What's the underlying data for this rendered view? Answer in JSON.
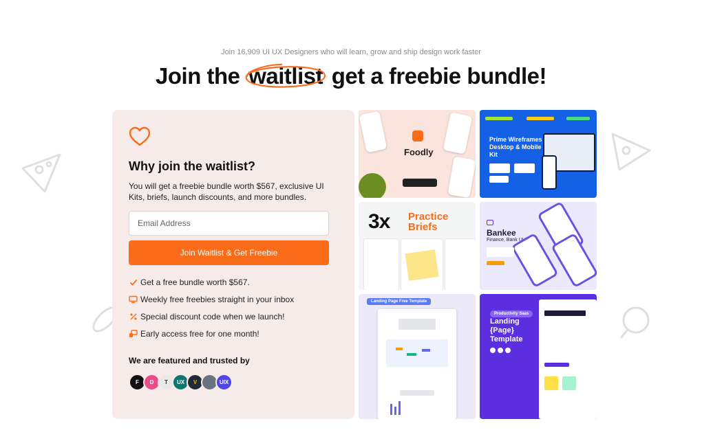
{
  "header": {
    "subtitle": "Join 16,909 UI UX Designers who will learn, grow and ship design work faster",
    "headline_before": "Join the",
    "headline_highlight": "waitlist",
    "headline_after": "get a freebie bundle!"
  },
  "card": {
    "heading": "Why join the waitlist?",
    "description": "You will get a freebie bundle worth $567, exclusive UI Kits, briefs, launch discounts, and more bundles.",
    "email_placeholder": "Email Address",
    "button_label": "Join Waitlist & Get Freebie",
    "benefits": [
      {
        "icon": "check-icon",
        "text": "Get a free bundle worth $567."
      },
      {
        "icon": "monitor-icon",
        "text": "Weekly free freebies straight in your inbox"
      },
      {
        "icon": "percent-icon",
        "text": "Special discount code when we launch!"
      },
      {
        "icon": "rocket-icon",
        "text": "Early access free for one month!"
      }
    ],
    "featured_label": "We are featured and trusted by",
    "featured_logos": [
      "F",
      "D",
      "T",
      "UX",
      "V",
      "",
      "UIX"
    ]
  },
  "tiles": {
    "foodly": "Foodly",
    "prime": "Prime Wireframes Desktop & Mobile Kit",
    "practice_count": "3x",
    "practice_label": "Practice Briefs",
    "bankee_title": "Bankee",
    "bankee_sub": "Finance, Bank UI Kit",
    "landing_badge": "Landing Page Free Template",
    "productivity_badge": "Productivity Saas",
    "productivity_title": "Landing {Page} Template"
  },
  "colors": {
    "accent": "#fa6b1a",
    "card_bg": "#f6ebe8"
  }
}
